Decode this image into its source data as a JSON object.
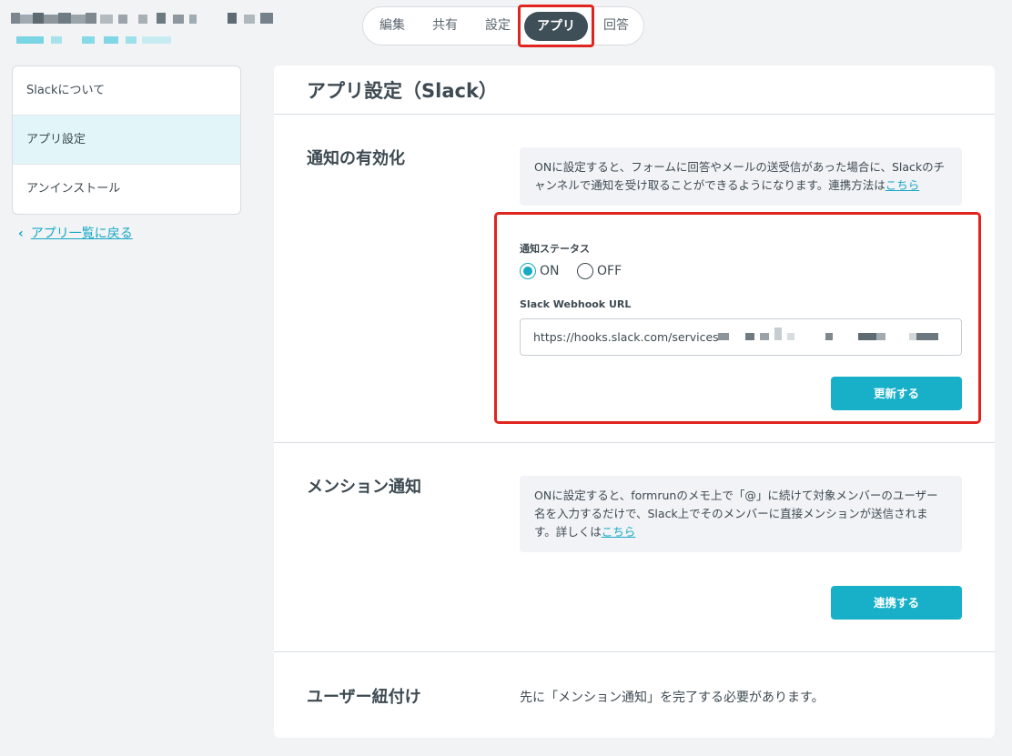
{
  "tabs": [
    {
      "label": "編集",
      "active": false
    },
    {
      "label": "共有",
      "active": false
    },
    {
      "label": "設定",
      "active": false
    },
    {
      "label": "アプリ",
      "active": true
    },
    {
      "label": "回答",
      "active": false
    }
  ],
  "sidebar": {
    "items": [
      {
        "label": "Slackについて",
        "active": false
      },
      {
        "label": "アプリ設定",
        "active": true
      },
      {
        "label": "アンインストール",
        "active": false
      }
    ],
    "back_link": "アプリ一覧に戻る"
  },
  "main": {
    "title": "アプリ設定（Slack）",
    "notification": {
      "title": "通知の有効化",
      "info_text": "ONに設定すると、フォームに回答やメールの送受信があった場合に、Slackのチャンネルで通知を受け取ることができるようになります。連携方法は",
      "info_link": "こちら",
      "status_label": "通知ステータス",
      "status_on": "ON",
      "status_off": "OFF",
      "selected": "ON",
      "webhook_label": "Slack Webhook URL",
      "webhook_value": "https://hooks.slack.com/services/T",
      "update_button": "更新する"
    },
    "mention": {
      "title": "メンション通知",
      "info_text": "ONに設定すると、formrunのメモ上で「@」に続けて対象メンバーのユーザー名を入力するだけで、Slack上でそのメンバーに直接メンションが送信されます。詳しくは",
      "info_link": "こちら",
      "connect_button": "連携する"
    },
    "user_link": {
      "title": "ユーザー紐付け",
      "text": "先に「メンション通知」を完了する必要があります。"
    }
  },
  "colors": {
    "accent": "#17b0c8",
    "highlight": "#e0241f",
    "active_tab": "#3f4f58"
  }
}
